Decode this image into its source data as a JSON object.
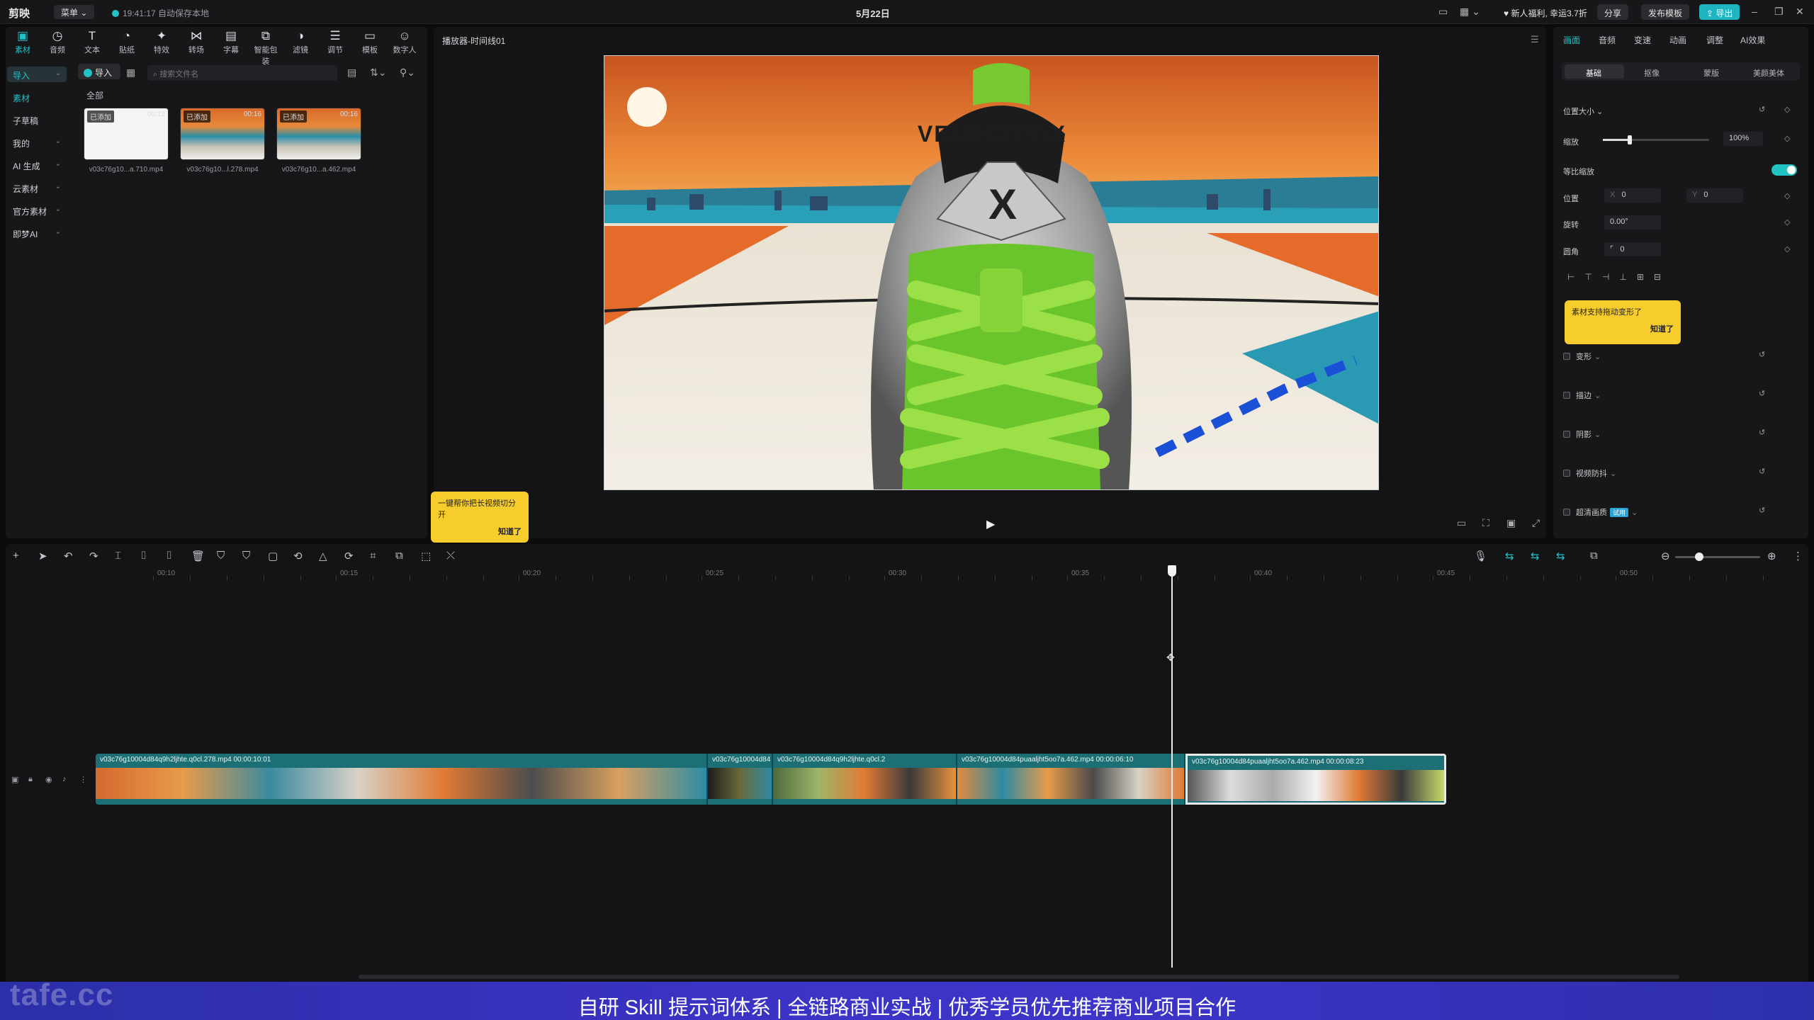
{
  "app": {
    "name": "剪映",
    "menu_label": "菜单",
    "autosave": "19:41:17 自动保存本地",
    "project_date": "5月22日"
  },
  "topbar": {
    "promo": "新人福利, 幸运3.7折",
    "share": "分享",
    "publish": "发布模板",
    "export": "导出"
  },
  "media_tools": [
    {
      "label": "素材",
      "icon": "media-icon"
    },
    {
      "label": "音频",
      "icon": "audio-icon"
    },
    {
      "label": "文本",
      "icon": "text-icon"
    },
    {
      "label": "贴纸",
      "icon": "sticker-icon"
    },
    {
      "label": "特效",
      "icon": "effects-icon"
    },
    {
      "label": "转场",
      "icon": "transition-icon"
    },
    {
      "label": "字幕",
      "icon": "subtitle-icon"
    },
    {
      "label": "智能包装",
      "icon": "smart-pack-icon"
    },
    {
      "label": "滤镜",
      "icon": "filter-icon"
    },
    {
      "label": "调节",
      "icon": "adjust-icon"
    },
    {
      "label": "模板",
      "icon": "template-icon"
    },
    {
      "label": "数字人",
      "icon": "avatar-icon"
    }
  ],
  "sidebar": [
    {
      "label": "导入",
      "chev": "⌄"
    },
    {
      "label": "素材",
      "chev": ""
    },
    {
      "label": "子草稿",
      "chev": ""
    },
    {
      "label": "我的",
      "chev": "⌄"
    },
    {
      "label": "AI 生成",
      "chev": "⌄"
    },
    {
      "label": "云素材",
      "chev": "⌄"
    },
    {
      "label": "官方素材",
      "chev": "⌄"
    },
    {
      "label": "即梦AI",
      "chev": "⌄"
    }
  ],
  "media": {
    "import_label": "导入",
    "search_placeholder": "搜索文件名",
    "category": "全部",
    "items": [
      {
        "badge": "已添加",
        "duration": "00:12",
        "name": "v03c76g10...a.710.mp4"
      },
      {
        "badge": "已添加",
        "duration": "00:16",
        "name": "v03c76g10...l.278.mp4"
      },
      {
        "badge": "已添加",
        "duration": "00:16",
        "name": "v03c76g10...a.462.mp4"
      }
    ]
  },
  "player": {
    "title": "播放器-时间线01",
    "video_text": "VELOCITY-X",
    "tip_text": "一键帮你把长视频切分开",
    "tip_ok": "知道了"
  },
  "inspector": {
    "tabs": [
      "画面",
      "音频",
      "变速",
      "动画",
      "调整",
      "AI效果"
    ],
    "sub_tabs": [
      "基础",
      "抠像",
      "蒙版",
      "美颜美体"
    ],
    "pos_size": "位置大小",
    "scale_label": "缩放",
    "scale_value": "100%",
    "scale_level": 0.25,
    "uniform_label": "等比缩放",
    "position_label": "位置",
    "pos_x_label": "X",
    "pos_x": "0",
    "pos_y_label": "Y",
    "pos_y": "0",
    "rotate_label": "旋转",
    "rotate_value": "0.00°",
    "corner_label": "圆角",
    "corner_value": "0",
    "tip_text": "素材支持拖动变形了",
    "tip_ok": "知道了",
    "sections": [
      "变形",
      "描边",
      "阴影",
      "视频防抖",
      "超清画质"
    ],
    "hdr_badge": "试用"
  },
  "timeline": {
    "ruler": [
      "00:10",
      "00:15",
      "00:20",
      "00:25",
      "00:30",
      "00:35",
      "00:40",
      "00:45",
      "00:50"
    ],
    "clips": [
      {
        "label": "v03c76g10004d84q9h2ljhte.q0cl.278.mp4  00:00:10:01"
      },
      {
        "label": "v03c76g10004d84"
      },
      {
        "label": "v03c76g10004d84q9h2ljhte.q0cl.2"
      },
      {
        "label": "v03c76g10004d84puaaljht5oo7a.462.mp4  00:00:06:10"
      },
      {
        "label": "v03c76g10004d84puaaljht5oo7a.462.mp4  00:00:08:23"
      }
    ]
  },
  "banner": {
    "text": "自研 Skill 提示词体系 | 全链路商业实战 | 优秀学员优先推荐商业项目合作",
    "watermark": "tafe.cc"
  }
}
